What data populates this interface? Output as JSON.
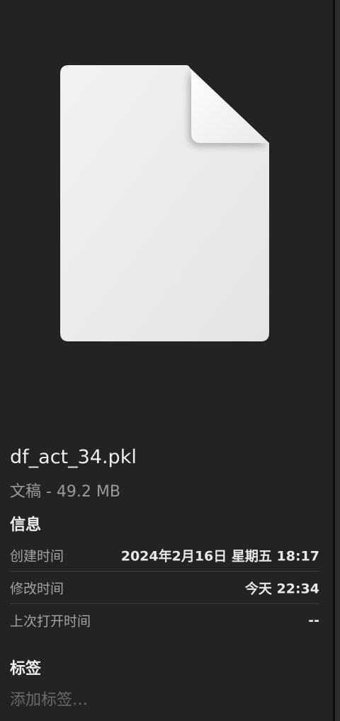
{
  "file": {
    "name": "df_act_34.pkl",
    "kind_size": "文稿 - 49.2 MB",
    "icon": "generic-document-icon"
  },
  "info": {
    "title": "信息",
    "rows": [
      {
        "label": "创建时间",
        "value": "2024年2月16日 星期五 18:17"
      },
      {
        "label": "修改时间",
        "value": "今天 22:34"
      },
      {
        "label": "上次打开时间",
        "value": "--"
      }
    ]
  },
  "tags": {
    "title": "标签",
    "placeholder": "添加标签…"
  },
  "colors": {
    "background": "#232323",
    "divider": "#3c3c3c",
    "label": "#a3a3a3",
    "value": "#e8e8e8"
  }
}
